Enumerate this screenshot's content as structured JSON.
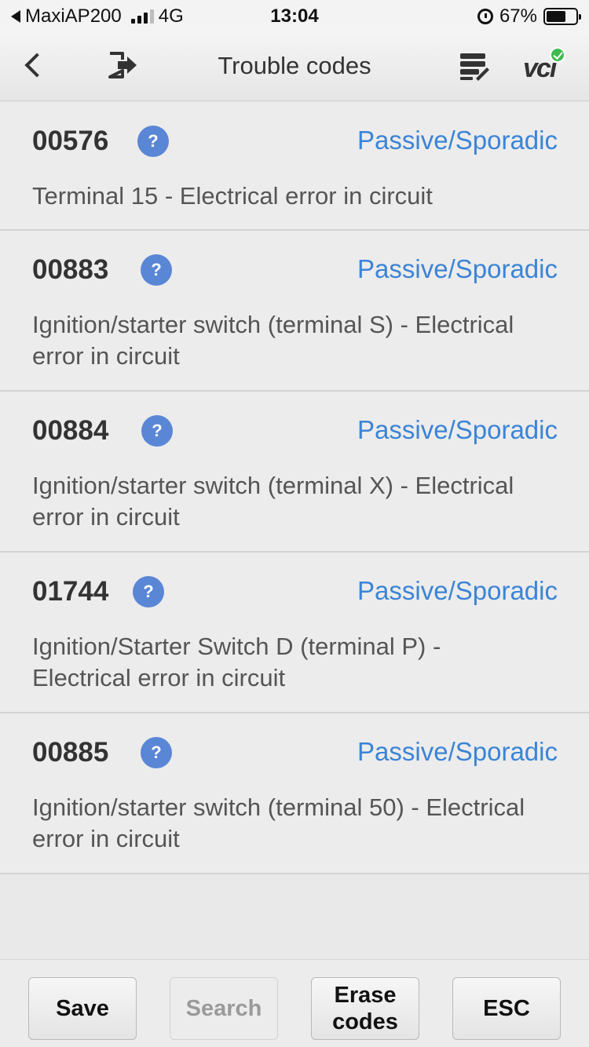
{
  "status_bar": {
    "carrier": "MaxiAP200",
    "network": "4G",
    "time": "13:04",
    "battery": "67%",
    "battery_level": 0.67
  },
  "nav": {
    "title": "Trouble codes",
    "vci_label": "vci"
  },
  "codes": [
    {
      "code": "00576",
      "status": "Passive/Sporadic",
      "description": "Terminal 15 - Electrical error in circuit"
    },
    {
      "code": "00883",
      "status": "Passive/Sporadic",
      "description": "Ignition/starter switch (terminal S) - Electrical error in circuit"
    },
    {
      "code": "00884",
      "status": "Passive/Sporadic",
      "description": "Ignition/starter switch (terminal X) - Electrical error in circuit"
    },
    {
      "code": "01744",
      "status": "Passive/Sporadic",
      "description": "Ignition/Starter Switch D (terminal P) - Electrical error in circuit"
    },
    {
      "code": "00885",
      "status": "Passive/Sporadic",
      "description": "Ignition/starter switch (terminal 50) - Electrical error in circuit"
    }
  ],
  "help_glyph": "?",
  "toolbar": {
    "save": "Save",
    "search": "Search",
    "erase": "Erase codes",
    "esc": "ESC"
  },
  "colors": {
    "status_blue": "#3c84d6",
    "help_blue": "#5a86d6",
    "vci_green": "#3dbb4e"
  }
}
